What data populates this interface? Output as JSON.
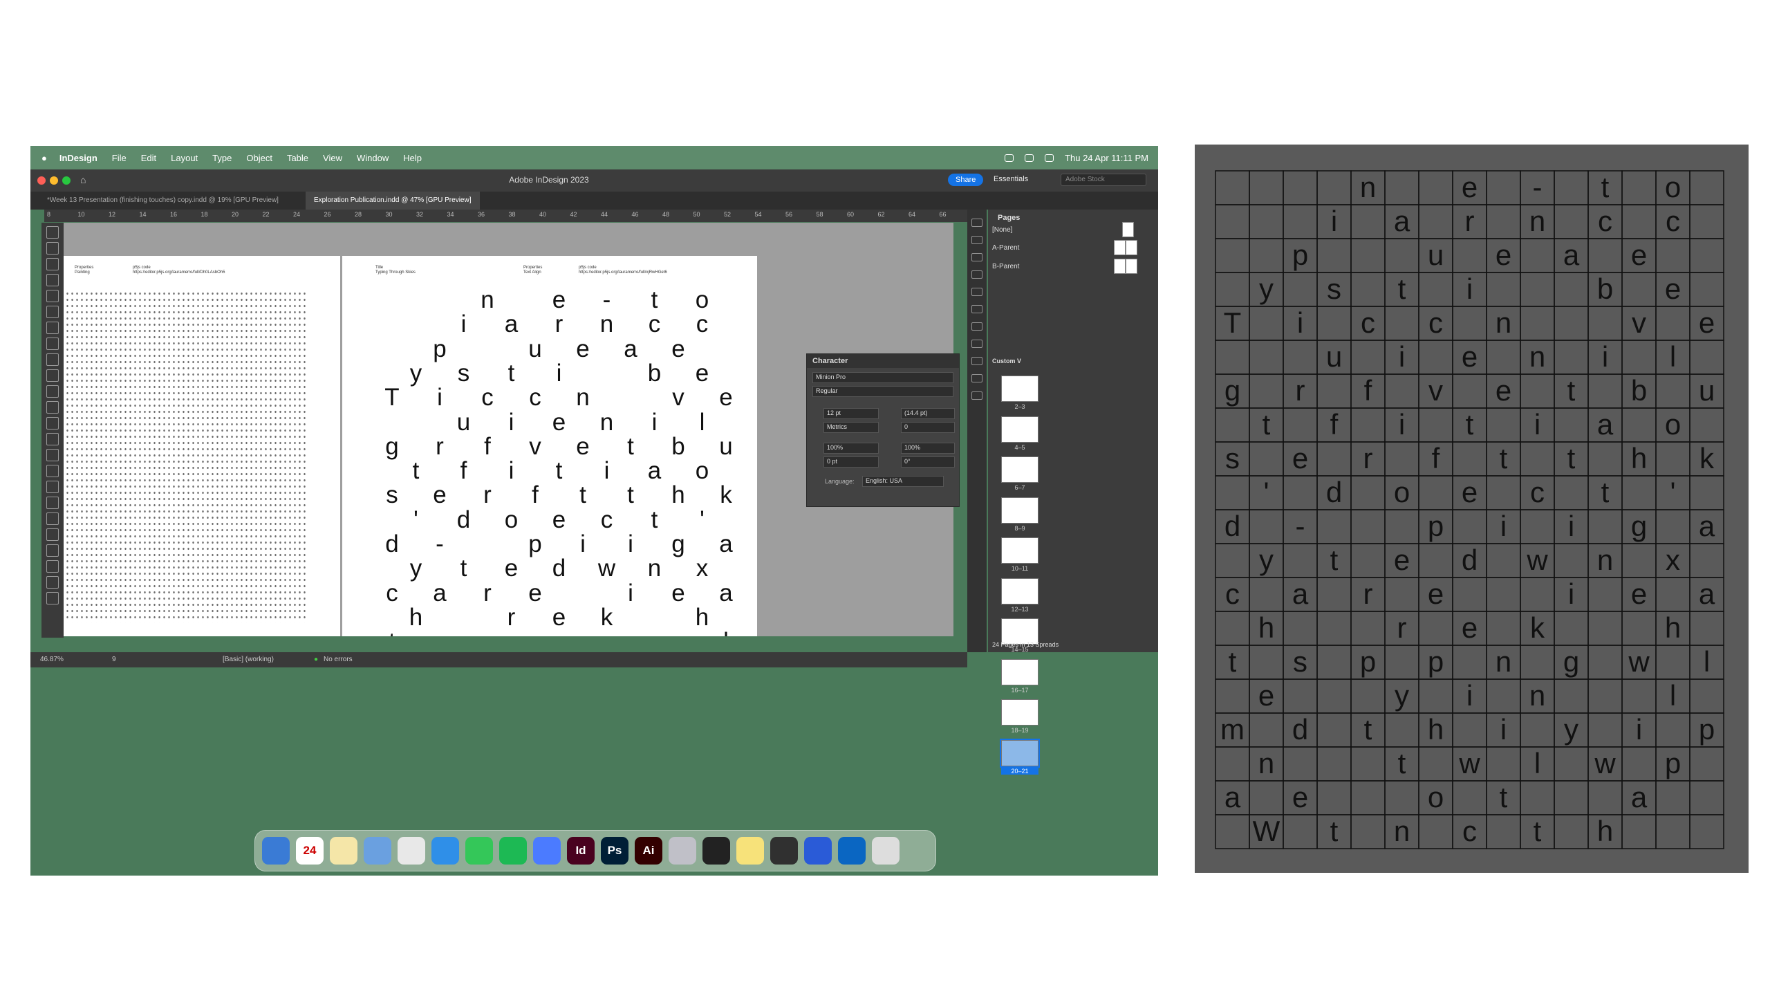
{
  "menubar": {
    "app": "InDesign",
    "menus": [
      "File",
      "Edit",
      "Layout",
      "Type",
      "Object",
      "Table",
      "View",
      "Window",
      "Help"
    ],
    "clock": "Thu 24 Apr  11:11 PM"
  },
  "titlebar": {
    "title": "Adobe InDesign 2023",
    "share": "Share",
    "workspace": "Essentials",
    "search_placeholder": "Adobe Stock"
  },
  "tabs": [
    "*Week 13 Presentation (finishing touches) copy.indd @ 19% [GPU Preview]",
    "Exploration Publication.indd @ 47% [GPU Preview]"
  ],
  "ruler": [
    "8",
    "10",
    "12",
    "14",
    "16",
    "18",
    "20",
    "22",
    "24",
    "26",
    "28",
    "30",
    "32",
    "34",
    "36",
    "38",
    "40",
    "42",
    "44",
    "46",
    "48",
    "50",
    "52",
    "54",
    "56",
    "58",
    "60",
    "62",
    "64",
    "66"
  ],
  "page_headers": {
    "left1": "Properties\nPainting",
    "left2": "p5js code\nhttps://editor.p5js.org/lauramerro/full/Dh0LAsbOh5",
    "right1": "Title\nTyping Through Skies",
    "right2": "Properties\nText Align",
    "right3": "p5js code\nhttps://editor.p5js.org/lauramerro/full/xjRwHGet6"
  },
  "letter_grid": [
    [
      "",
      "",
      "",
      "",
      "n",
      "",
      "",
      "e",
      "",
      "-",
      "",
      "t",
      "",
      "o"
    ],
    [
      "",
      "",
      "",
      "i",
      "",
      "a",
      "",
      "r",
      "",
      "n",
      "",
      "c",
      "",
      "c"
    ],
    [
      "",
      "",
      "p",
      "",
      "",
      "",
      "u",
      "",
      "e",
      "",
      "a",
      "",
      "e",
      ""
    ],
    [
      "",
      "y",
      "",
      "s",
      "",
      "t",
      "",
      "i",
      "",
      "",
      "",
      "b",
      "",
      "e"
    ],
    [
      "T",
      "",
      "i",
      "",
      "c",
      "",
      "c",
      "",
      "n",
      "",
      "",
      "",
      "v",
      "",
      "e"
    ],
    [
      "",
      "",
      "",
      "u",
      "",
      "i",
      "",
      "e",
      "",
      "n",
      "",
      "i",
      "",
      "l"
    ],
    [
      "g",
      "",
      "r",
      "",
      "f",
      "",
      "v",
      "",
      "e",
      "",
      "t",
      "",
      "b",
      "",
      "u"
    ],
    [
      "",
      "t",
      "",
      "f",
      "",
      "i",
      "",
      "t",
      "",
      "i",
      "",
      "a",
      "",
      "o"
    ],
    [
      "s",
      "",
      "e",
      "",
      "r",
      "",
      "f",
      "",
      "t",
      "",
      "t",
      "",
      "h",
      "",
      "k"
    ],
    [
      "",
      "'",
      "",
      "d",
      "",
      "o",
      "",
      "e",
      "",
      "c",
      "",
      "t",
      "",
      "'"
    ],
    [
      "d",
      "",
      "-",
      "",
      "",
      "",
      "p",
      "",
      "i",
      "",
      "i",
      "",
      "g",
      "",
      "a"
    ],
    [
      "",
      "y",
      "",
      "t",
      "",
      "e",
      "",
      "d",
      "",
      "w",
      "",
      "n",
      "",
      "x"
    ],
    [
      "c",
      "",
      "a",
      "",
      "r",
      "",
      "e",
      "",
      "",
      "",
      "i",
      "",
      "e",
      "",
      "a"
    ],
    [
      "",
      "h",
      "",
      "",
      "",
      "r",
      "",
      "e",
      "",
      "k",
      "",
      "",
      "",
      "h"
    ],
    [
      "t",
      "",
      "s",
      "",
      "p",
      "",
      "p",
      "",
      "n",
      "",
      "g",
      "",
      "w",
      "",
      "l"
    ],
    [
      "",
      "e",
      "",
      "",
      "",
      "y",
      "",
      "i",
      "",
      "n",
      "",
      "",
      "",
      "l"
    ],
    [
      "m",
      "",
      "d",
      "",
      "t",
      "",
      "h",
      "",
      "i",
      "",
      "y",
      "",
      "i",
      "",
      "p"
    ],
    [
      "",
      "n",
      "",
      "",
      "",
      "t",
      "",
      "w",
      "",
      "l",
      "",
      "w",
      "",
      "p"
    ],
    [
      "a",
      "",
      "e",
      "",
      "",
      "",
      "o",
      "",
      "t",
      "",
      "",
      "",
      "a",
      ""
    ],
    [
      "",
      "W",
      "",
      "t",
      "",
      "n",
      "",
      "c",
      "",
      "t",
      "",
      "h",
      ""
    ]
  ],
  "character_panel": {
    "title": "Character",
    "font": "Minion Pro",
    "style": "Regular",
    "size": "12 pt",
    "leading": "(14.4 pt)",
    "kerning": "Metrics",
    "tracking": "0",
    "vscale": "100%",
    "hscale": "100%",
    "baseline": "0 pt",
    "skew": "0°",
    "language_label": "Language:",
    "language": "English: USA"
  },
  "pages_panel": {
    "title": "Pages",
    "none": "[None]",
    "a_parent": "A-Parent",
    "b_parent": "B-Parent",
    "view": "Custom V",
    "spreads": [
      "2–3",
      "4–5",
      "6–7",
      "8–9",
      "10–11",
      "12–13",
      "14–15",
      "16–17",
      "18–19",
      "20–21"
    ],
    "selected": "20–21",
    "footer": "24 Pages in 13 Spreads"
  },
  "status": {
    "zoom": "46.87%",
    "page": "9",
    "style": "[Basic] (working)",
    "errors": "No errors"
  },
  "dock": [
    {
      "label": "",
      "color": "#3a7bd5"
    },
    {
      "label": "24",
      "color": "#ffffff"
    },
    {
      "label": "",
      "color": "#f5e6a8"
    },
    {
      "label": "",
      "color": "#6aa0e0"
    },
    {
      "label": "",
      "color": "#e8e8e8"
    },
    {
      "label": "",
      "color": "#2f8fe8"
    },
    {
      "label": "",
      "color": "#34c759"
    },
    {
      "label": "",
      "color": "#1db954"
    },
    {
      "label": "",
      "color": "#4b7bff"
    },
    {
      "label": "Id",
      "color": "#49021f"
    },
    {
      "label": "Ps",
      "color": "#001e36"
    },
    {
      "label": "Ai",
      "color": "#330000"
    },
    {
      "label": "",
      "color": "#c0c0c8"
    },
    {
      "label": "",
      "color": "#222222"
    },
    {
      "label": "",
      "color": "#f7e27a"
    },
    {
      "label": "",
      "color": "#303030"
    },
    {
      "label": "",
      "color": "#2a5bd7"
    },
    {
      "label": "",
      "color": "#0a66c2"
    },
    {
      "label": "",
      "color": "#dddddd"
    }
  ]
}
